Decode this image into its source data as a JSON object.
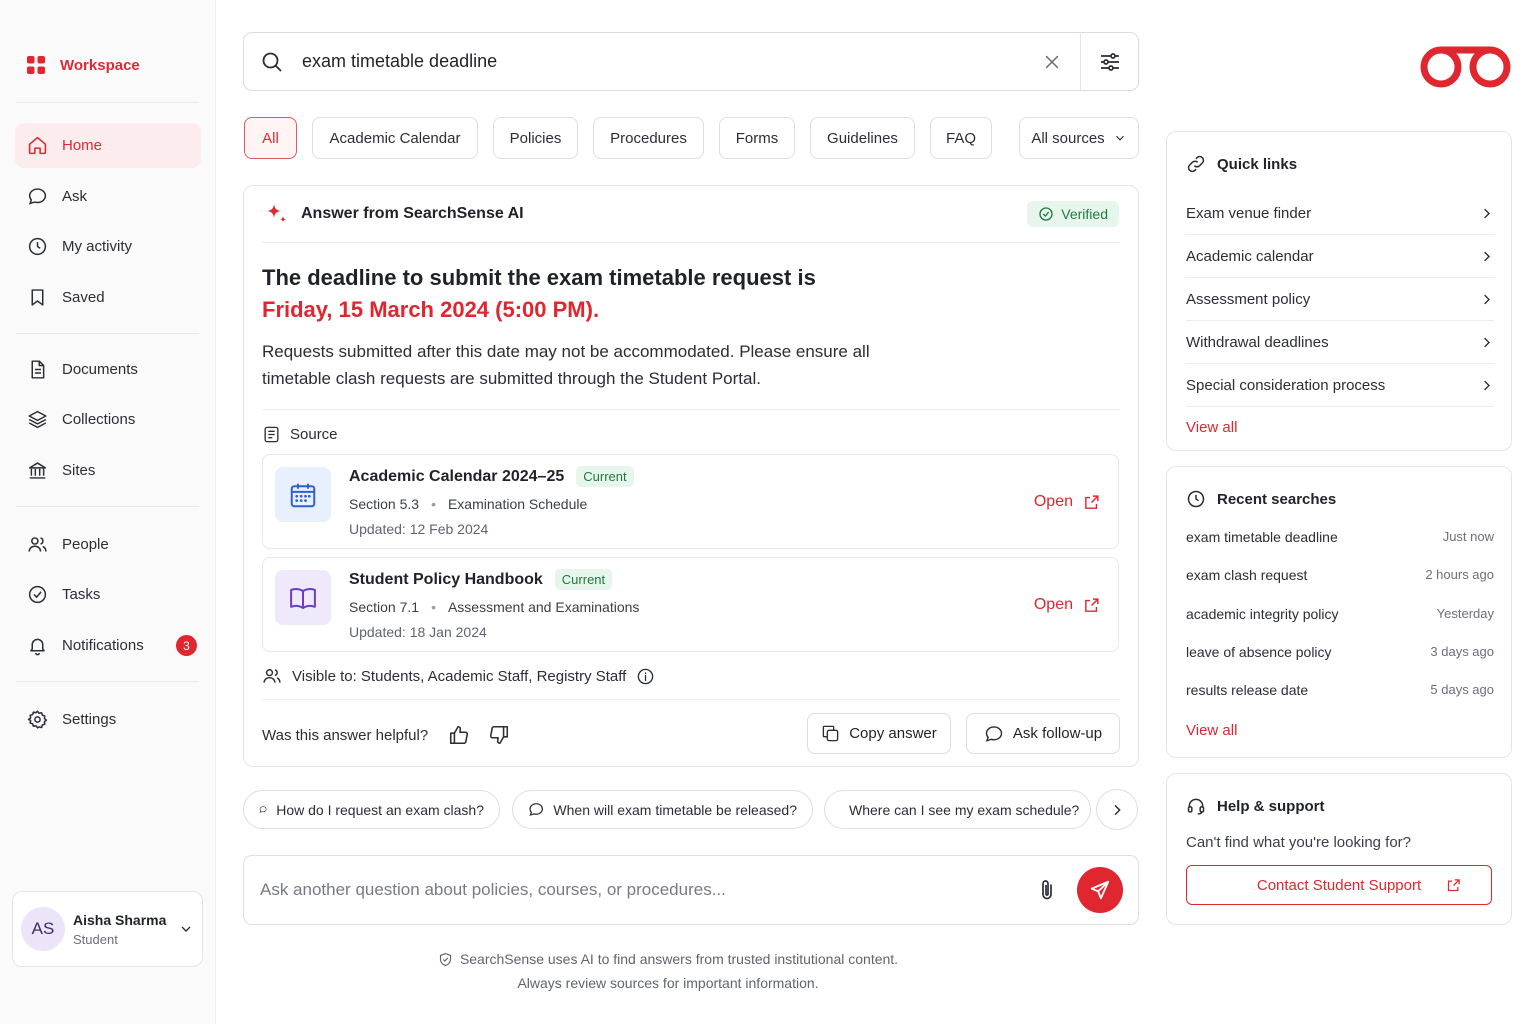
{
  "sidebar": {
    "workspace": "Workspace",
    "nav": [
      "Home",
      "Ask",
      "My activity",
      "Saved",
      "Documents",
      "Collections",
      "Sites",
      "People",
      "Tasks",
      "Notifications",
      "Settings"
    ],
    "notifications_count": "3",
    "user": {
      "initials": "AS",
      "name": "Aisha Sharma",
      "role": "Student"
    }
  },
  "search": {
    "query": "exam timetable deadline"
  },
  "filters": {
    "tabs": [
      "All",
      "Academic Calendar",
      "Policies",
      "Procedures",
      "Forms",
      "Guidelines",
      "FAQ"
    ],
    "active": "All",
    "sources": "All sources"
  },
  "answer": {
    "header": "Answer from SearchSense AI",
    "verified": "Verified",
    "headline_1": "The deadline to submit the exam timetable request is",
    "headline_2": "Friday, 15 March 2024 (5:00 PM).",
    "body": "Requests submitted after this date may not be accommodated. Please ensure all timetable clash requests are submitted through the Student Portal.",
    "source_label": "Source",
    "sources": [
      {
        "title": "Academic Calendar 2024–25",
        "badge": "Current",
        "section": "Section 5.3",
        "topic": "Examination Schedule",
        "updated": "Updated: 12 Feb 2024",
        "open": "Open"
      },
      {
        "title": "Student Policy Handbook",
        "badge": "Current",
        "section": "Section 7.1",
        "topic": "Assessment and Examinations",
        "updated": "Updated: 18 Jan 2024",
        "open": "Open"
      }
    ],
    "visible_to": "Visible to: Students, Academic Staff, Registry Staff",
    "helpful": "Was this answer helpful?",
    "copy": "Copy answer",
    "followup": "Ask follow-up"
  },
  "suggestions": [
    "How do I request an exam clash?",
    "When will exam timetable be released?",
    "Where can I see my exam schedule?"
  ],
  "ask": {
    "placeholder": "Ask another question about policies, courses, or procedures..."
  },
  "footer": {
    "line1": "SearchSense uses AI to find answers from trusted institutional content.",
    "line2": "Always review sources for important information."
  },
  "quick_links": {
    "title": "Quick links",
    "items": [
      "Exam venue finder",
      "Academic calendar",
      "Assessment policy",
      "Withdrawal deadlines",
      "Special consideration process"
    ],
    "view_all": "View all"
  },
  "recent": {
    "title": "Recent searches",
    "items": [
      {
        "q": "exam timetable deadline",
        "t": "Just now"
      },
      {
        "q": "exam clash request",
        "t": "2 hours ago"
      },
      {
        "q": "academic integrity policy",
        "t": "Yesterday"
      },
      {
        "q": "leave of absence policy",
        "t": "3 days ago"
      },
      {
        "q": "results release date",
        "t": "5 days ago"
      }
    ],
    "view_all": "View all"
  },
  "help": {
    "title": "Help & support",
    "text": "Can't find what you're looking for?",
    "button": "Contact Student Support"
  },
  "colors": {
    "accent": "#e0262f",
    "active_bg": "#fdeced",
    "success_bg": "#e6f6ec",
    "success": "#1f7a3f"
  }
}
